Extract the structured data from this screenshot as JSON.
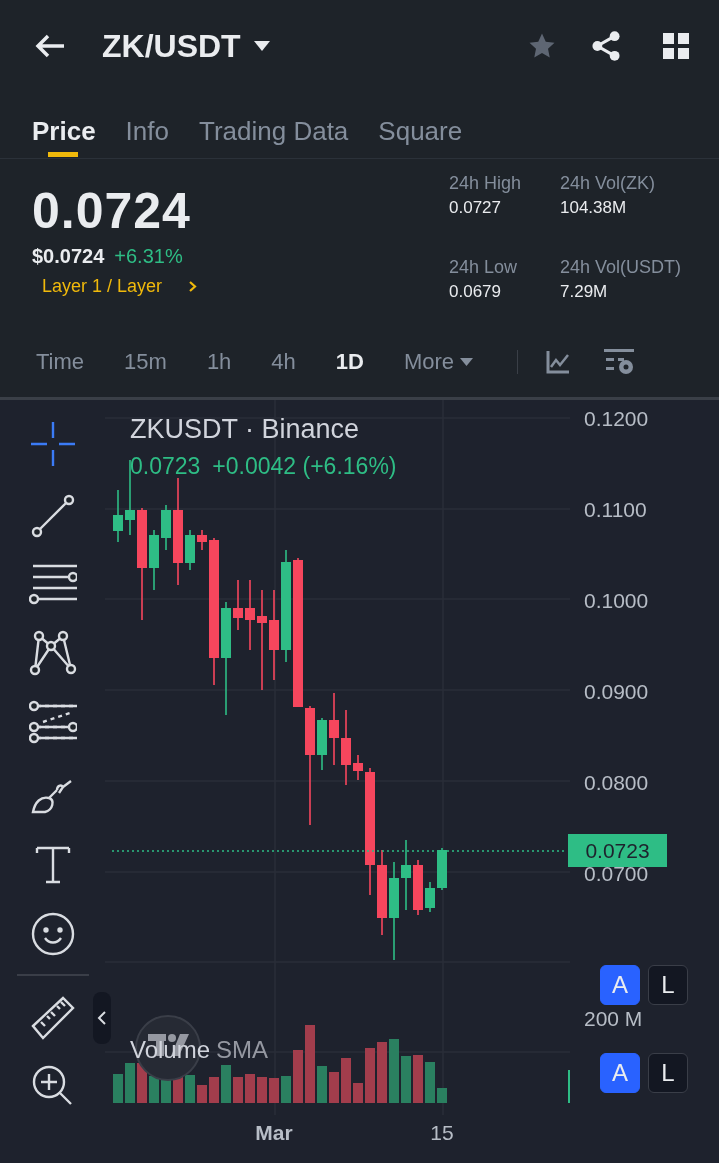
{
  "header": {
    "title": "ZK/USDT"
  },
  "tabs": [
    {
      "label": "Price",
      "selected": true
    },
    {
      "label": "Info",
      "selected": false
    },
    {
      "label": "Trading Data",
      "selected": false
    },
    {
      "label": "Square",
      "selected": false
    }
  ],
  "ticker": {
    "price": "0.0724",
    "usd_price": "$0.0724",
    "change": "+6.31%",
    "category": "Layer 1 / Layer"
  },
  "stats": [
    {
      "label": "24h High",
      "value": "0.0727"
    },
    {
      "label": "24h Vol(ZK)",
      "value": "104.38M"
    },
    {
      "label": "24h Low",
      "value": "0.0679"
    },
    {
      "label": "24h Vol(USDT)",
      "value": "7.29M"
    }
  ],
  "intervals": [
    {
      "label": "Time",
      "selected": false
    },
    {
      "label": "15m",
      "selected": false
    },
    {
      "label": "1h",
      "selected": false
    },
    {
      "label": "4h",
      "selected": false
    },
    {
      "label": "1D",
      "selected": true
    },
    {
      "label": "More",
      "selected": false
    }
  ],
  "tools": [
    {
      "kind": "crosshair",
      "selected": true
    },
    {
      "kind": "trend-line",
      "selected": false
    },
    {
      "kind": "horizontal-lines",
      "selected": false
    },
    {
      "kind": "pattern",
      "selected": false
    },
    {
      "kind": "fib",
      "selected": false
    },
    {
      "kind": "brush",
      "selected": false
    },
    {
      "kind": "text",
      "selected": false
    },
    {
      "kind": "emoji",
      "selected": false
    },
    {
      "kind": "ruler",
      "selected": false
    },
    {
      "kind": "zoom",
      "selected": false
    }
  ],
  "chart": {
    "symbol": "ZKUSDT · Binance",
    "last": "0.0723",
    "change": "+0.0042 (+6.16%)",
    "price_axis": [
      "0.1200",
      "0.1100",
      "0.1000",
      "0.0900",
      "0.0800",
      "0.0700"
    ],
    "last_price_label": "0.0723",
    "volume_axis": "200 M",
    "volume_label": "Volume",
    "volume_sma": "SMA",
    "time_axis": [
      "Mar",
      "15"
    ],
    "price_scale_buttons": [
      {
        "label": "A",
        "selected": true
      },
      {
        "label": "L",
        "selected": false
      }
    ],
    "volume_scale_buttons": [
      {
        "label": "A",
        "selected": true
      },
      {
        "label": "L",
        "selected": false
      }
    ]
  }
}
